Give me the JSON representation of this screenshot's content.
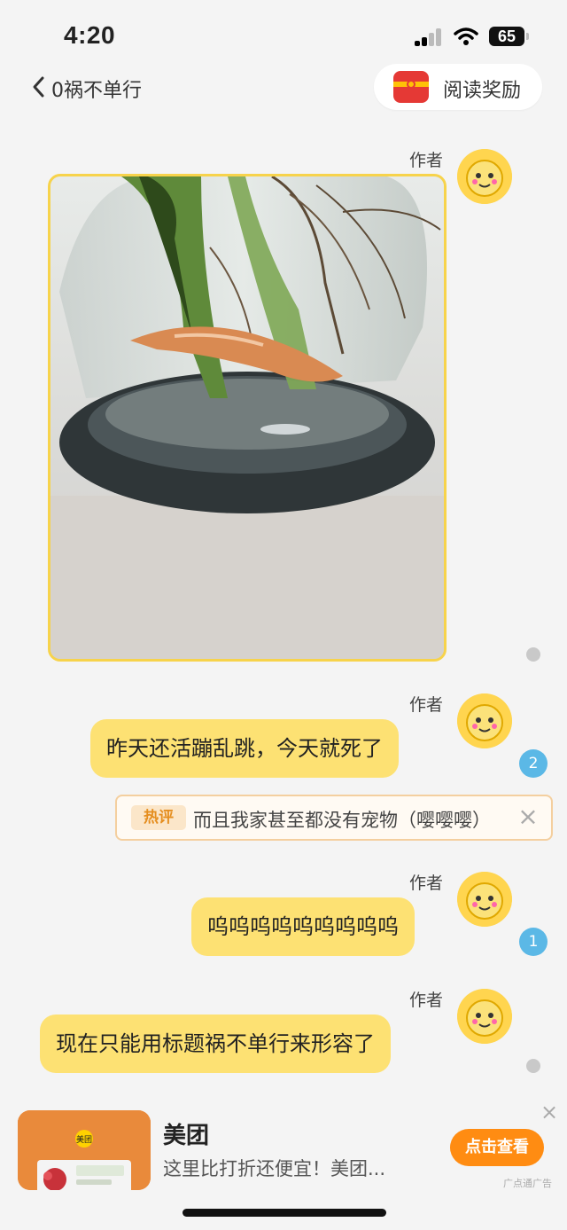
{
  "status_bar": {
    "time": "4:20",
    "battery": "65"
  },
  "nav": {
    "back_title": "0祸不单行",
    "reward_label": "阅读奖励"
  },
  "author_label": "作者",
  "messages": [
    {
      "type": "image"
    },
    {
      "type": "text",
      "text": "昨天还活蹦乱跳，今天就死了",
      "count": "2"
    },
    {
      "type": "text",
      "text": "呜呜呜呜呜呜呜呜呜",
      "count": "1"
    },
    {
      "type": "text",
      "text": "现在只能用标题祸不单行来形容了"
    }
  ],
  "hot_comment": {
    "tag": "热评",
    "text": "而且我家甚至都没有宠物（嘤嘤嘤）"
  },
  "ad": {
    "title": "美团",
    "description": "这里比打折还便宜！美团...",
    "button": "点击查看",
    "label": "广点通广告",
    "logo_text": "美团"
  },
  "colors": {
    "bubble": "#fde173",
    "accent_button": "#ff8c12",
    "badge": "#5bb8e6"
  }
}
